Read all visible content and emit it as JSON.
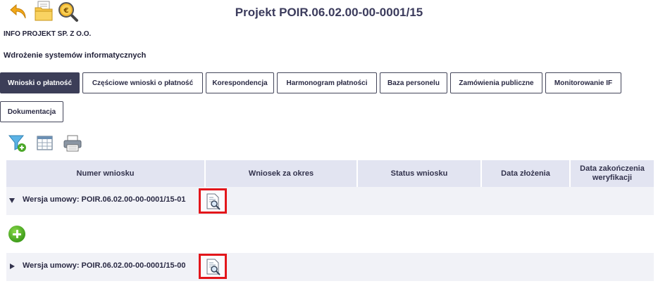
{
  "header": {
    "title": "Projekt POIR.06.02.00-00-0001/15",
    "company": "INFO PROJEKT SP. Z O.O.",
    "project_name": "Wdrożenie systemów informatycznych"
  },
  "toolbar": {
    "icons": [
      "back-arrow-icon",
      "folder-icon",
      "euro-search-icon"
    ]
  },
  "tabs": [
    {
      "label": "Wnioski o płatność",
      "active": true
    },
    {
      "label": "Częściowe wnioski o płatność",
      "active": false
    },
    {
      "label": "Korespondencja",
      "active": false
    },
    {
      "label": "Harmonogram płatności",
      "active": false
    },
    {
      "label": "Baza personelu",
      "active": false
    },
    {
      "label": "Zamówienia publiczne",
      "active": false
    },
    {
      "label": "Monitorowanie IF",
      "active": false
    },
    {
      "label": "Dokumentacja",
      "active": false
    }
  ],
  "actions": {
    "icons": [
      "filter-add-icon",
      "table-columns-icon",
      "printer-icon"
    ]
  },
  "table": {
    "columns": [
      "Numer wniosku",
      "Wniosek za okres",
      "Status wniosku",
      "Data złożenia",
      "Data zakończenia weryfikacji"
    ]
  },
  "groups": [
    {
      "label": "Wersja umowy: POIR.06.02.00-00-0001/15-01",
      "expanded": true
    },
    {
      "label": "Wersja umowy: POIR.06.02.00-00-0001/15-00",
      "expanded": false
    }
  ],
  "colors": {
    "accent": "#3c3e58",
    "highlight": "#e3161b",
    "header_bg": "#e2e4f1",
    "add_green": "#3f9d1b"
  }
}
